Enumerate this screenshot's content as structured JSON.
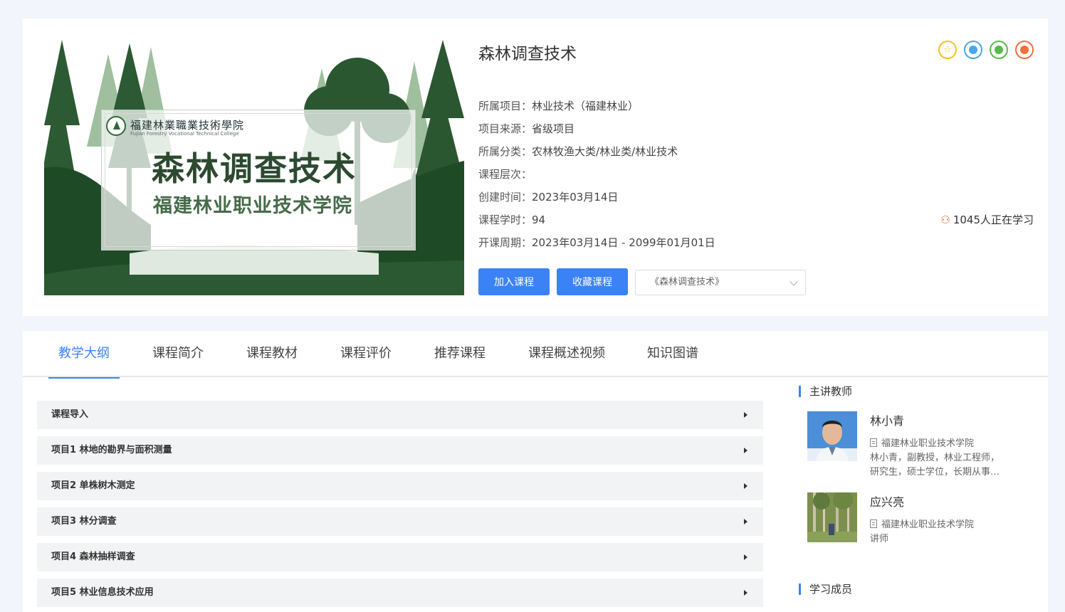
{
  "course": {
    "title": "森林调查技术",
    "cover": {
      "school_cn": "福建林業職業技術學院",
      "school_en": "Fujian Forestry Vocational Technical College",
      "title": "森林调查技术",
      "subtitle": "福建林业职业技术学院"
    },
    "meta": [
      {
        "key": "所属项目：",
        "value": "林业技术（福建林业）"
      },
      {
        "key": "项目来源：",
        "value": "省级项目"
      },
      {
        "key": "所属分类：",
        "value": "农林牧渔大类/林业类/林业技术"
      },
      {
        "key": "课程层次：",
        "value": ""
      },
      {
        "key": "创建时间：",
        "value": "2023年03月14日"
      },
      {
        "key": "课程学时：",
        "value": "94"
      },
      {
        "key": "开课周期：",
        "value": "2023年03月14日 - 2099年01月01日"
      }
    ],
    "learners": "1045人正在学习",
    "buttons": {
      "join": "加入课程",
      "favorite": "收藏课程"
    },
    "select_value": "《森林调查技术》"
  },
  "share": [
    {
      "name": "collect-icon",
      "glyph": "☆"
    },
    {
      "name": "qq-icon",
      "glyph": ""
    },
    {
      "name": "wechat-icon",
      "glyph": ""
    },
    {
      "name": "weibo-icon",
      "glyph": ""
    }
  ],
  "tabs": [
    "教学大纲",
    "课程简介",
    "课程教材",
    "课程评价",
    "推荐课程",
    "课程概述视频",
    "知识图谱"
  ],
  "outline": [
    "课程导入",
    "项目1 林地的勘界与面积测量",
    "项目2 单株树木测定",
    "项目3 林分调查",
    "项目4 森林抽样调查",
    "项目5 林业信息技术应用"
  ],
  "sidebar": {
    "teachers_title": "主讲教师",
    "members_title": "学习成员",
    "teachers": [
      {
        "name": "林小青",
        "school": "福建林业职业技术学院",
        "desc1": "林小青，副教授，林业工程师，",
        "desc2": "研究生，硕士学位，长期从事…"
      },
      {
        "name": "应兴亮",
        "school": "福建林业职业技术学院",
        "desc1": "讲师",
        "desc2": ""
      }
    ]
  },
  "colors": {
    "accent": "#3b82f6",
    "forest_dark": "#1f4a26"
  }
}
